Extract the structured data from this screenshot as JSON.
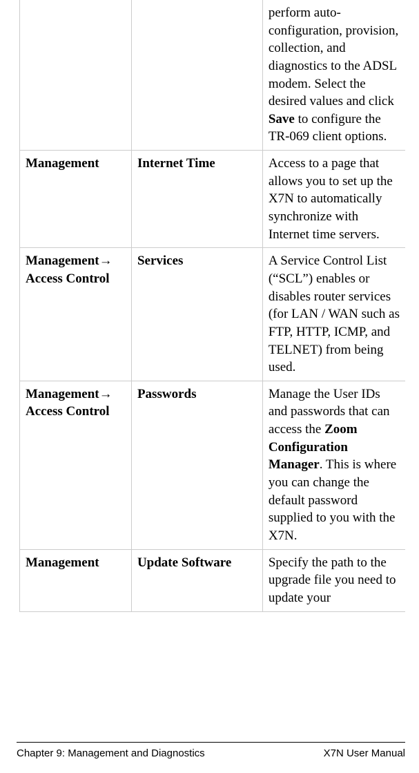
{
  "rows": [
    {
      "col1_plain": "",
      "col1_bold": "",
      "col2_bold": "",
      "desc_pre": "perform auto-configuration, provision, collection, and diagnostics to the ADSL modem. Select the desired values and click ",
      "desc_bold1": "Save",
      "desc_mid": " to configure the TR-069 client options.",
      "desc_bold2": "",
      "desc_post": ""
    },
    {
      "col1_plain": "",
      "col1_bold": "Management",
      "col2_bold": "Internet Time",
      "desc_pre": "Access to a page that allows you to set up the X7N to automatically synchronize with Internet time servers.",
      "desc_bold1": "",
      "desc_mid": "",
      "desc_bold2": "",
      "desc_post": ""
    },
    {
      "col1_plain": "",
      "col1_bold": "Management",
      "col1_arrow": "→",
      "col1_bold2": "Access Control",
      "col2_bold": "Services",
      "desc_pre": "A Service Control List (“SCL”) enables or disables router services (for LAN / WAN such as FTP, HTTP, ICMP, and TELNET) from being used.",
      "desc_bold1": "",
      "desc_mid": "",
      "desc_bold2": "",
      "desc_post": ""
    },
    {
      "col1_plain": "",
      "col1_bold": "Management",
      "col1_arrow": "→",
      "col1_bold2": "Access Control",
      "col2_bold": "Passwords",
      "desc_pre": "Manage the User IDs and passwords that can access the ",
      "desc_bold1": "Zoom Configuration Manager",
      "desc_mid": ". This is where you can change the default password supplied to you with the X7N.",
      "desc_bold2": "",
      "desc_post": ""
    },
    {
      "col1_plain": "",
      "col1_bold": "Management",
      "col2_bold": "Update Software",
      "desc_pre": "Specify the path to the upgrade file you need to update your",
      "desc_bold1": "",
      "desc_mid": "",
      "desc_bold2": "",
      "desc_post": ""
    }
  ],
  "footer": {
    "left": "Chapter 9: Management and Diagnostics",
    "right": "X7N User Manual"
  }
}
